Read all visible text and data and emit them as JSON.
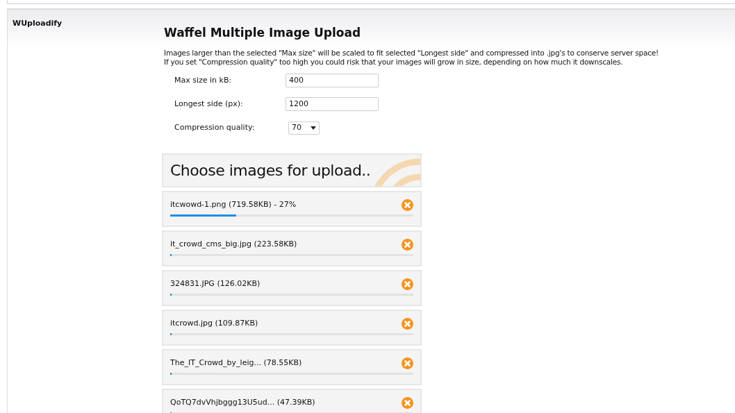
{
  "module": {
    "title": "WUploadify"
  },
  "heading": "Waffel Multiple Image Upload",
  "intro": [
    "Images larger than the selected \"Max size\" will be scaled to fit selected \"Longest side\" and compressed into .jpg's to conserve server space!",
    "If you set \"Compression quality\" too high you could risk that your images will grow in size, depending on how much it downscales."
  ],
  "settings": [
    {
      "kind": "text",
      "label": "Max size in kB:",
      "value": "400"
    },
    {
      "kind": "text",
      "label": "Longest side (px):",
      "value": "1200"
    },
    {
      "kind": "select",
      "label": "Compression quality:",
      "value": "70"
    }
  ],
  "upload_button": "Choose images for upload..",
  "queue": [
    {
      "name": "itcwowd-1.png (719.58KB) - 27%",
      "level": 0.27
    },
    {
      "name": "it_crowd_cms_big.jpg (223.58KB)",
      "level": 0.005
    },
    {
      "name": "324831.JPG (126.02KB)",
      "level": 0.005
    },
    {
      "name": "itcrowd.jpg (109.87KB)",
      "level": 0.005
    },
    {
      "name": "The_IT_Crowd_by_leig... (78.55KB)",
      "level": 0.005
    },
    {
      "name": "QoTQ7dvVhjbggg13U5ud... (47.39KB)",
      "level": 0.005
    }
  ]
}
